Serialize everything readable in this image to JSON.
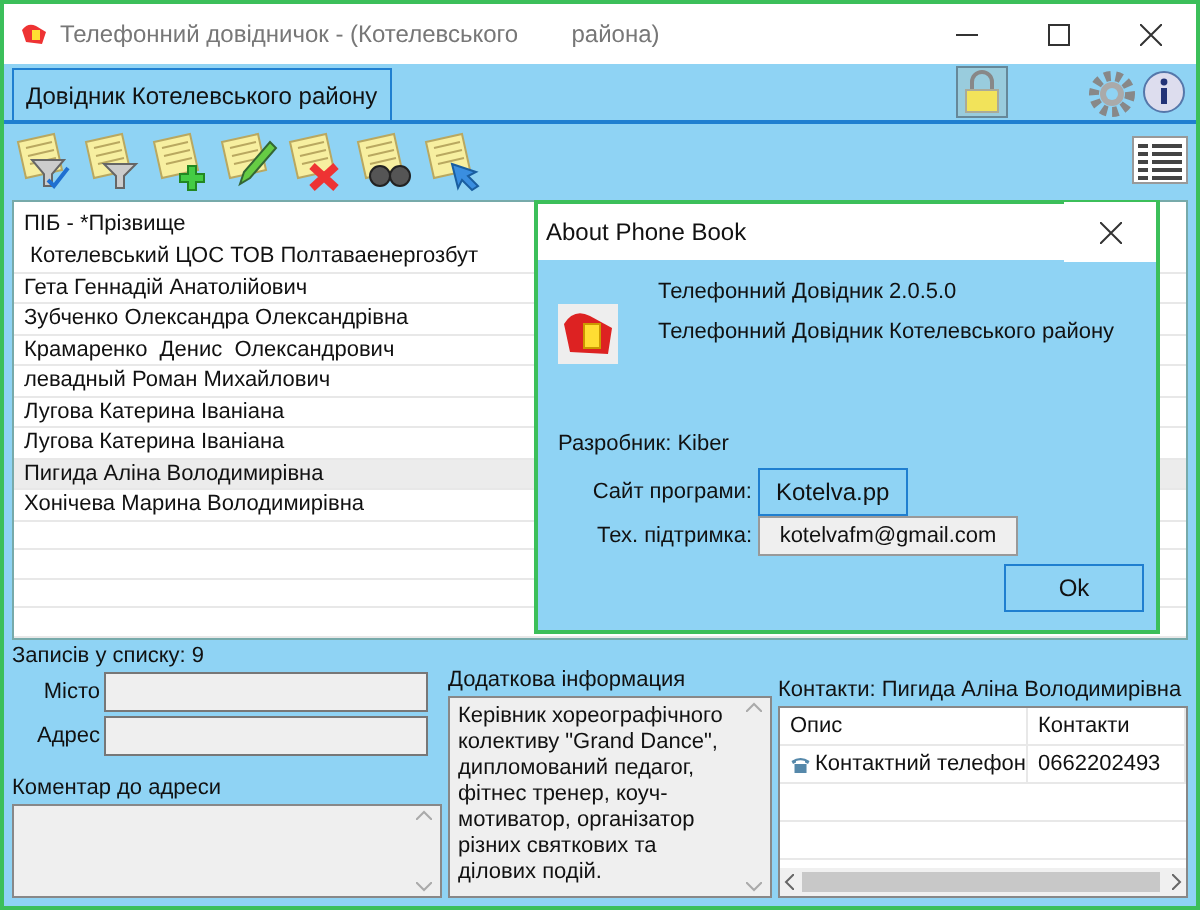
{
  "window": {
    "title": "Телефонний довідничок - (Котелевського        района)"
  },
  "tabs": [
    {
      "label": "Довідник Котелевського району",
      "selected": true
    }
  ],
  "list": {
    "header": "ПІБ - *Прізвище",
    "rows": [
      {
        "name": " Котелевський ЦОС ТОВ Полтаваенергозбут",
        "selected": false
      },
      {
        "name": "Гета Геннадій Анатолійович",
        "selected": false
      },
      {
        "name": "Зубченко Олександра Олександрівна",
        "selected": false
      },
      {
        "name": "Крамаренко  Денис  Олександрович",
        "selected": false
      },
      {
        "name": "левадный Роман Михайлович",
        "selected": false
      },
      {
        "name": "Лугова Катерина Іваніана",
        "selected": false
      },
      {
        "name": "Лугова Катерина Іваніана",
        "selected": false
      },
      {
        "name": "Пигида Аліна Володимирівна",
        "selected": true
      },
      {
        "name": "Хонічева Марина Володимирівна",
        "selected": false
      }
    ]
  },
  "record_count": "Записів у списку: 9",
  "address": {
    "city_label": "Місто",
    "address_label": "Адрес",
    "comment_label": "Коментар до адреси"
  },
  "extra_info": {
    "label": "Додаткова інформация",
    "text": "Керівник хореографічного колективу \"Grand Dance\", дипломований педагог, фітнес тренер, коуч-мотиватор, організатор різних святкових та ділових подій."
  },
  "contacts": {
    "label": "Контакти: Пигида Аліна Володимирівна",
    "columns": [
      "Опис",
      "Контакти"
    ],
    "rows": [
      {
        "description": "Контактний телефон",
        "value": "0662202493"
      }
    ]
  },
  "dialog": {
    "title": "About Phone Book",
    "version": "Телефонний Довідник 2.0.5.0",
    "product": "Телефонний Довідник Котелевського району",
    "developer": "Разробник: Kiber",
    "site_label": "Сайт програми:",
    "site": "Kotelva.pp",
    "support_label": "Тех. підтримка:",
    "support": "kotelvafm@gmail.com",
    "ok": "Ok"
  }
}
